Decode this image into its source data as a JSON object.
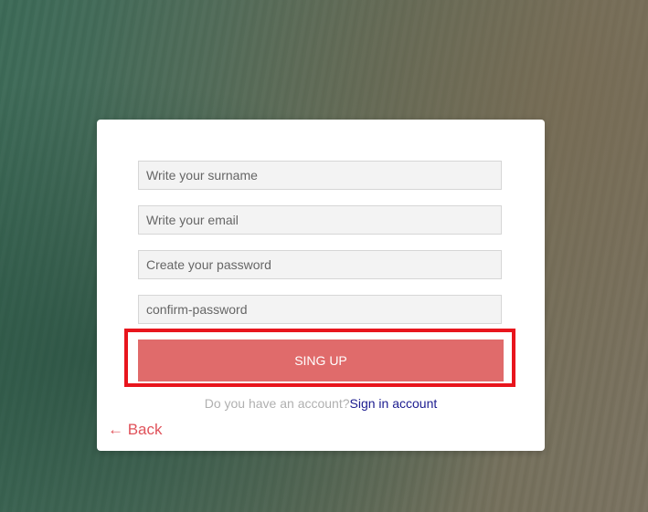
{
  "form": {
    "surname_placeholder": "Write your surname",
    "email_placeholder": "Write your email",
    "password_placeholder": "Create your password",
    "confirm_placeholder": "confirm-password",
    "submit_label": "SING UP",
    "account_question": "Do you have an account?",
    "signin_link": "Sign in account",
    "back_label": "← Back"
  },
  "colors": {
    "button": "#e06b6b",
    "highlight": "#e8151d",
    "link": "#1b1b8f",
    "back": "#e0525a"
  }
}
